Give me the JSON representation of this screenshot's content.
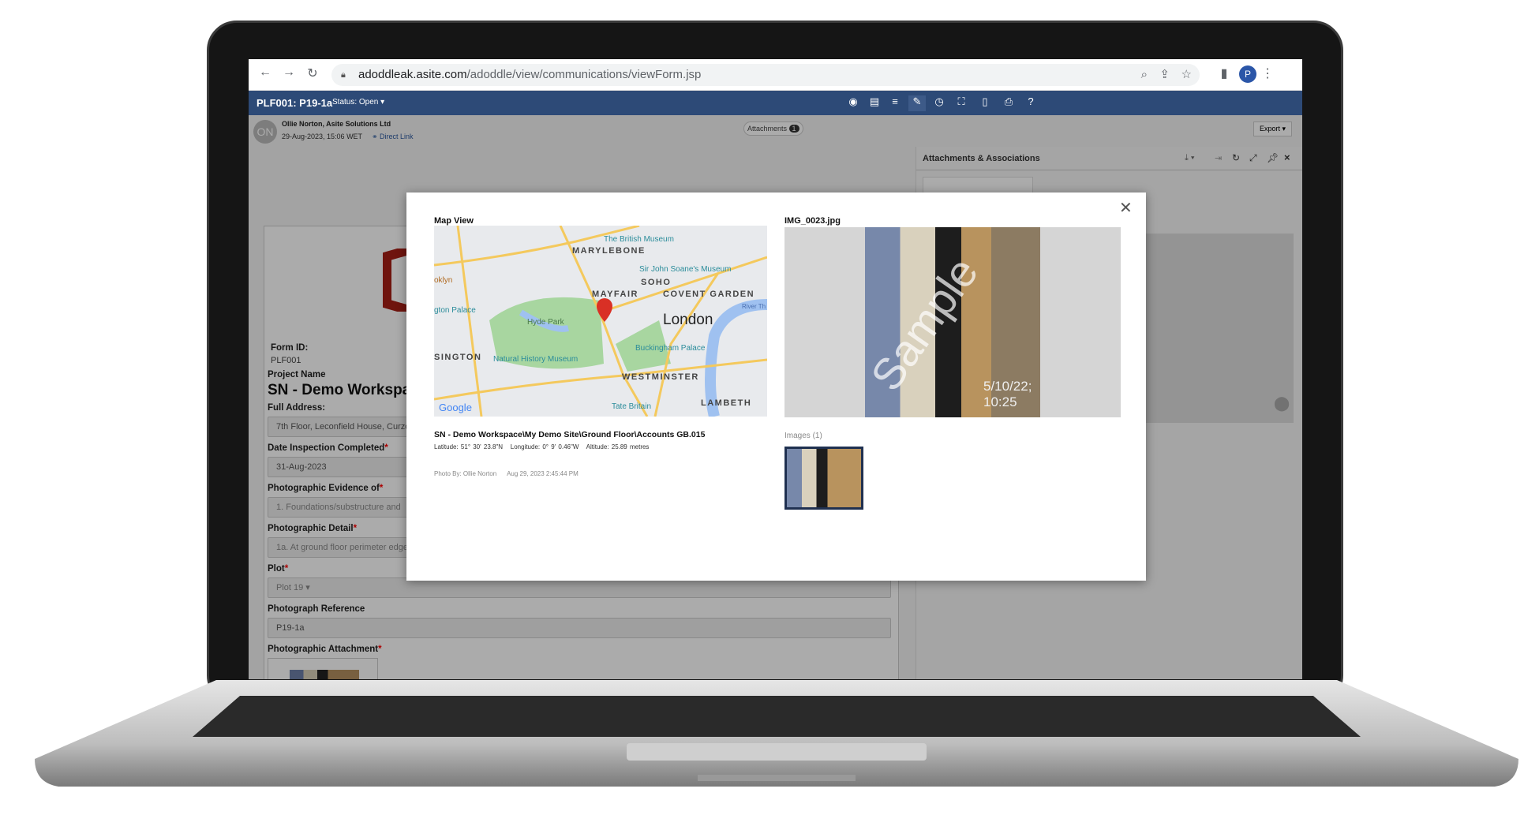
{
  "browser": {
    "url_host": "adoddleak.asite.com",
    "url_path": "/adoddle/view/communications/viewForm.jsp",
    "profile_initial": "P"
  },
  "app": {
    "form_title": "PLF001: P19-1a",
    "status": "Status: Open",
    "brand_color": "#2d4a77"
  },
  "info": {
    "avatar": "ON",
    "author": "Ollie Norton, Asite Solutions Ltd",
    "date": "29-Aug-2023, 15:06 WET",
    "direct_link": "Direct Link",
    "attachments_label": "Attachments",
    "attachments_count": "1",
    "export": "Export"
  },
  "form": {
    "form_id_label": "Form ID:",
    "form_id": "PLF001",
    "project_label": "Project Name",
    "project": "SN - Demo Workspace",
    "address_label": "Full Address:",
    "address": "7th Floor, Leconfield House, Curzon Street",
    "date_label": "Date Inspection Completed",
    "date": "31-Aug-2023",
    "evidence_label": "Photographic Evidence of",
    "evidence": "1. Foundations/substructure and",
    "detail_label": "Photographic Detail",
    "detail": "1a. At ground floor perimeter edge",
    "plot_label": "Plot",
    "plot": "Plot 19",
    "ref_label": "Photograph Reference",
    "ref": "P19-1a",
    "attach_label": "Photographic Attachment"
  },
  "right_panel": {
    "title": "Attachments & Associations"
  },
  "modal": {
    "map_title": "Map View",
    "map_labels": {
      "marylebone": "MARYLEBONE",
      "british_museum": "The British Museum",
      "soane": "Sir John Soane's Museum",
      "soho": "SOHO",
      "mayfair": "MAYFAIR",
      "covent": "COVENT GARDEN",
      "london": "London",
      "hyde": "Hyde Park",
      "palace": "gton Palace",
      "brooklyn": "oklyn",
      "sington": "SINGTON",
      "nhm": "Natural History Museum",
      "buck": "Buckingham Palace",
      "westminster": "WESTMINSTER",
      "tate": "Tate Britain",
      "lambeth": "LAMBETH",
      "river": "River Th",
      "google": "Google"
    },
    "location": "SN - Demo Workspace\\My Demo Site\\Ground Floor\\Accounts GB.015",
    "latitude": "Latitude: 51° 30' 23.8\"N",
    "longitude": "Longitude: 0° 9' 0.46\"W",
    "altitude": "Altitude: 25.89 metres",
    "photo_by": "Photo By: Ollie Norton",
    "photo_date": "Aug 29, 2023 2:45:44 PM",
    "image_name": "IMG_0023.jpg",
    "watermark": "Sample",
    "stamp1": "5/10/22;",
    "stamp2": "10:25",
    "images_label": "Images (1)"
  }
}
